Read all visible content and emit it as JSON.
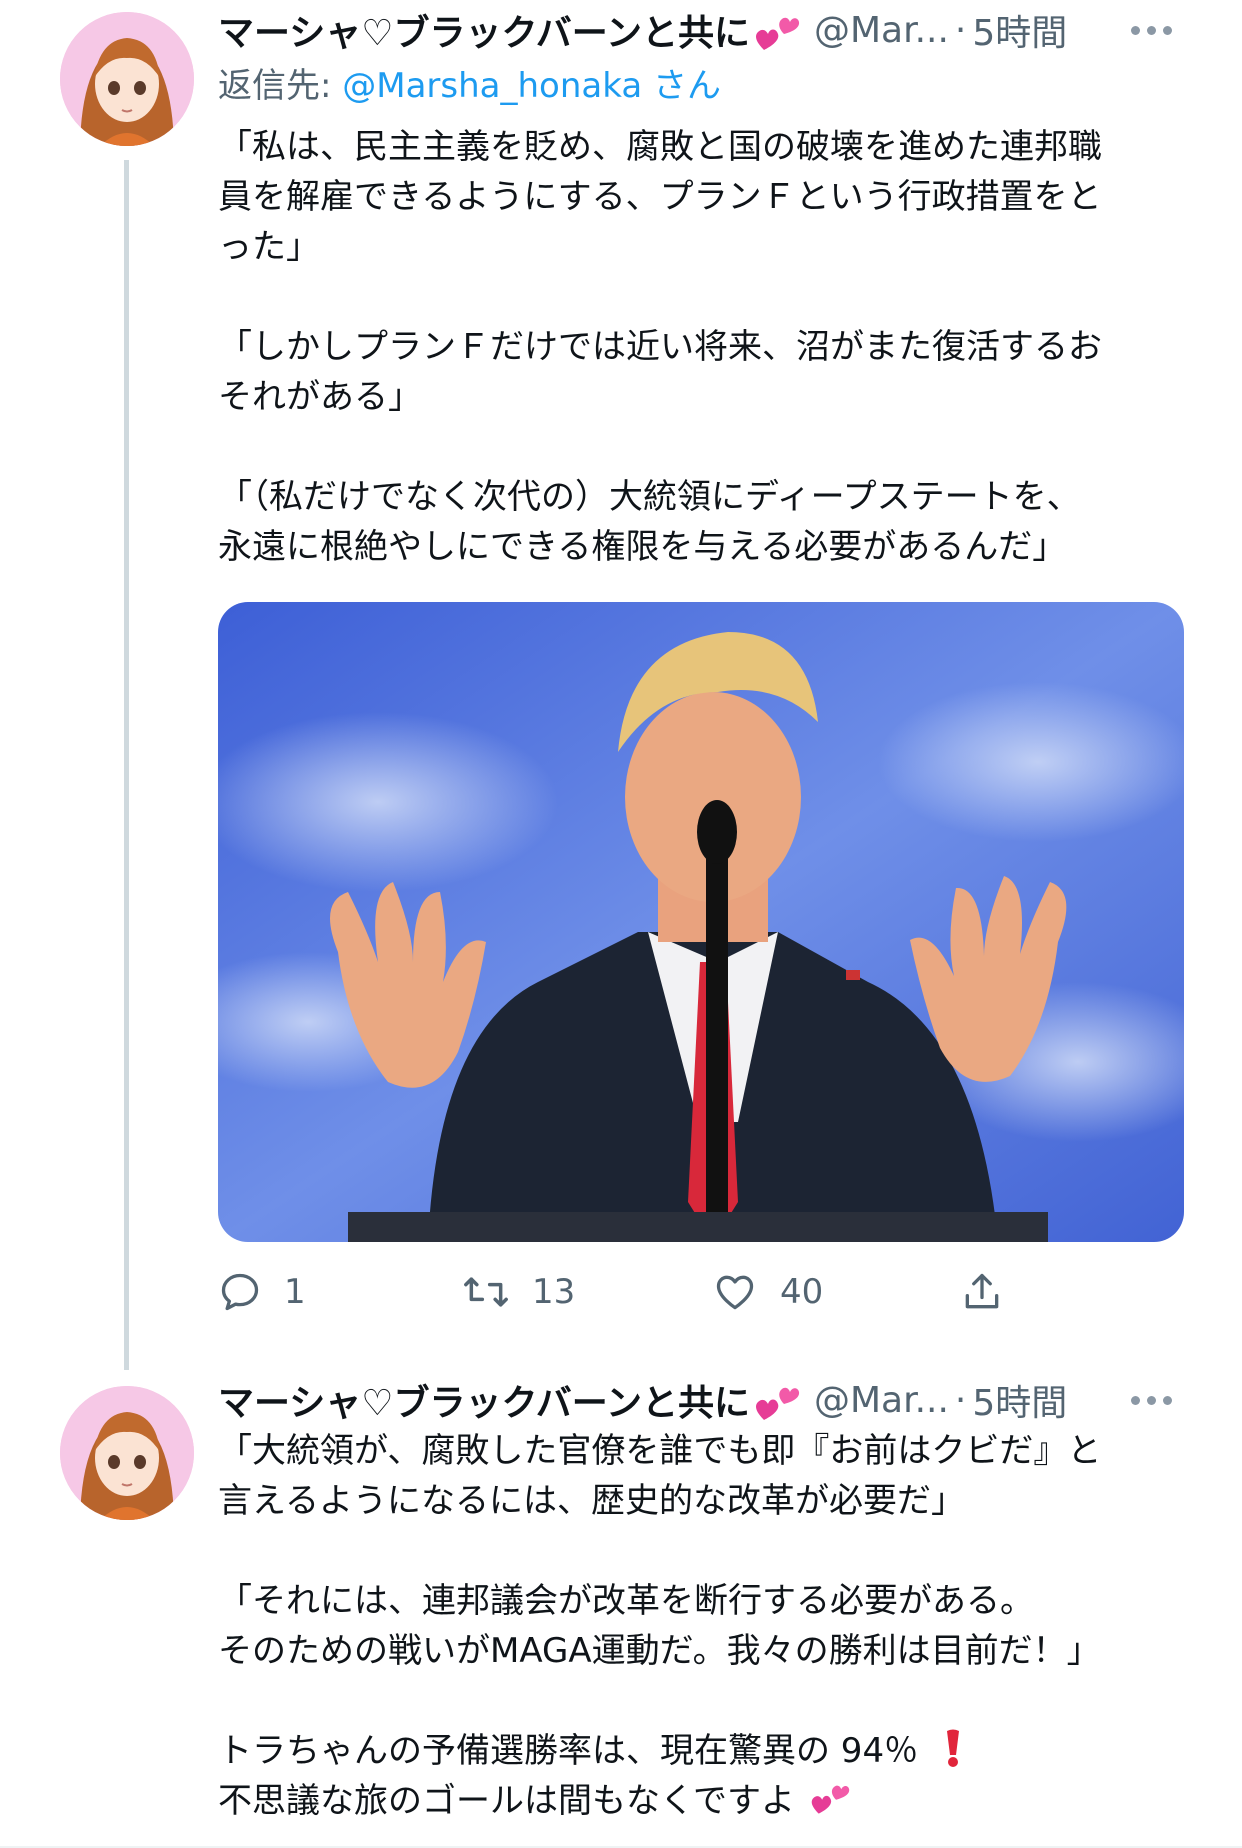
{
  "tweets": [
    {
      "display_name": "マーシャ♡ブラックバーンと共に",
      "name_emoji": "two-hearts-emoji",
      "handle": "@Mar...",
      "separator": "·",
      "time": "5時間",
      "reply_to_prefix": "返信先: ",
      "reply_to_handle": "@Marsha_honaka",
      "reply_to_suffix": " さん",
      "paragraphs": [
        [
          "「私は、民主主義を貶め、腐敗と国の破壊を進めた連邦職",
          "員を解雇できるようにする、プランＦという行政措置をと",
          "った」"
        ],
        [
          "「しかしプランＦだけでは近い将来、沼がまた復活するお",
          "それがある」"
        ],
        [
          "「（私だけでなく次代の）大統領にディープステートを、",
          "永遠に根絶やしにできる権限を与える必要があるんだ」"
        ]
      ],
      "actions": {
        "reply_count": "1",
        "retweet_count": "13",
        "like_count": "40"
      }
    },
    {
      "display_name": "マーシャ♡ブラックバーンと共に",
      "name_emoji": "two-hearts-emoji",
      "handle": "@Mar...",
      "separator": "·",
      "time": "5時間",
      "paragraphs": [
        [
          "「大統領が、腐敗した官僚を誰でも即『お前はクビだ』と",
          "言えるようになるには、歴史的な改革が必要だ」"
        ],
        [
          "「それには、連邦議会が改革を断行する必要がある。",
          "そのための戦いがMAGA運動だ。我々の勝利は目前だ！」"
        ],
        [
          "トラちゃんの予備選勝率は、現在驚異の 94％",
          "不思議な旅のゴールは間もなくですよ"
        ]
      ]
    }
  ],
  "icons": {
    "reply": "reply-icon",
    "retweet": "retweet-icon",
    "like": "heart-icon",
    "share": "share-icon",
    "more": "more-icon",
    "exclamation": "red-exclamation-emoji"
  },
  "colors": {
    "text": "#0f1419",
    "secondary": "#536471",
    "link": "#1d9bf0",
    "thread_line": "#cfd9de"
  }
}
